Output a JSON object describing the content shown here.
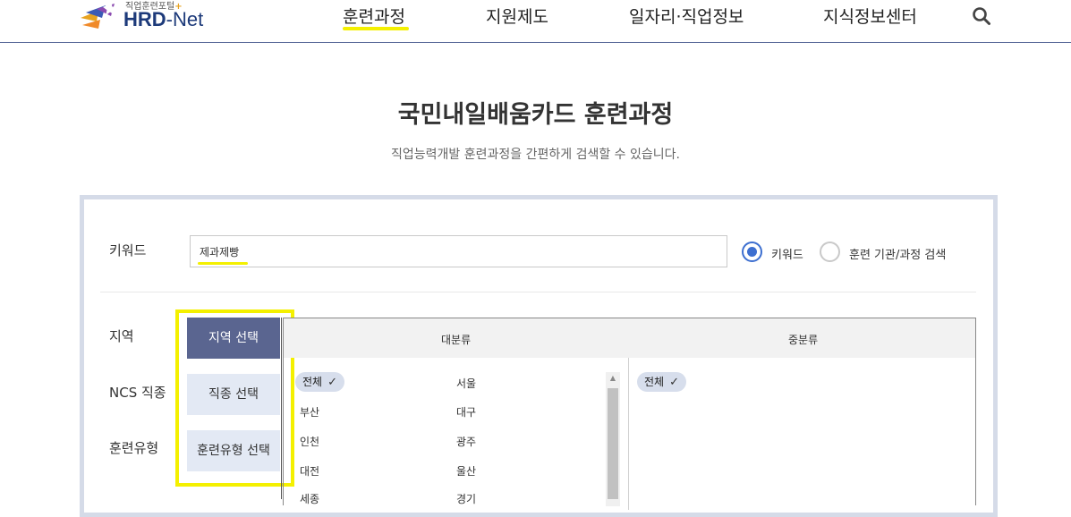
{
  "header": {
    "logo_small": "직업훈련포털",
    "logo_plus": "+",
    "logo_hrd": "HRD",
    "logo_dash": "-",
    "logo_net": "Net",
    "nav": [
      {
        "label": "훈련과정",
        "active": true
      },
      {
        "label": "지원제도"
      },
      {
        "label": "일자리·직업정보"
      },
      {
        "label": "지식정보센터"
      }
    ]
  },
  "page": {
    "title": "국민내일배움카드 훈련과정",
    "subtitle": "직업능력개발 훈련과정을 간편하게 검색할 수 있습니다."
  },
  "search": {
    "keyword_label": "키워드",
    "keyword_value": "제과제빵",
    "radio_keyword": "키워드",
    "radio_institution": "훈련 기관/과정 검색",
    "radio_selected": "키워드"
  },
  "filters": {
    "region_label": "지역",
    "ncs_label": "NCS 직종",
    "type_label": "훈련유형",
    "region_btn": "지역 선택",
    "ncs_btn": "직종 선택",
    "type_btn": "훈련유형 선택"
  },
  "category": {
    "major_header": "대분류",
    "minor_header": "중분류",
    "all_chip": "전체",
    "minor_all_chip": "전체",
    "left_col": [
      "부산",
      "인천",
      "대전",
      "세종"
    ],
    "right_col": [
      "서울",
      "대구",
      "광주",
      "울산",
      "경기"
    ]
  },
  "colors": {
    "accent": "#3d6fd0",
    "highlight": "#f4f000",
    "active_button": "#5a6590",
    "chip": "#d7deec"
  },
  "icons": {
    "search": "search-icon",
    "check": "check-icon"
  }
}
